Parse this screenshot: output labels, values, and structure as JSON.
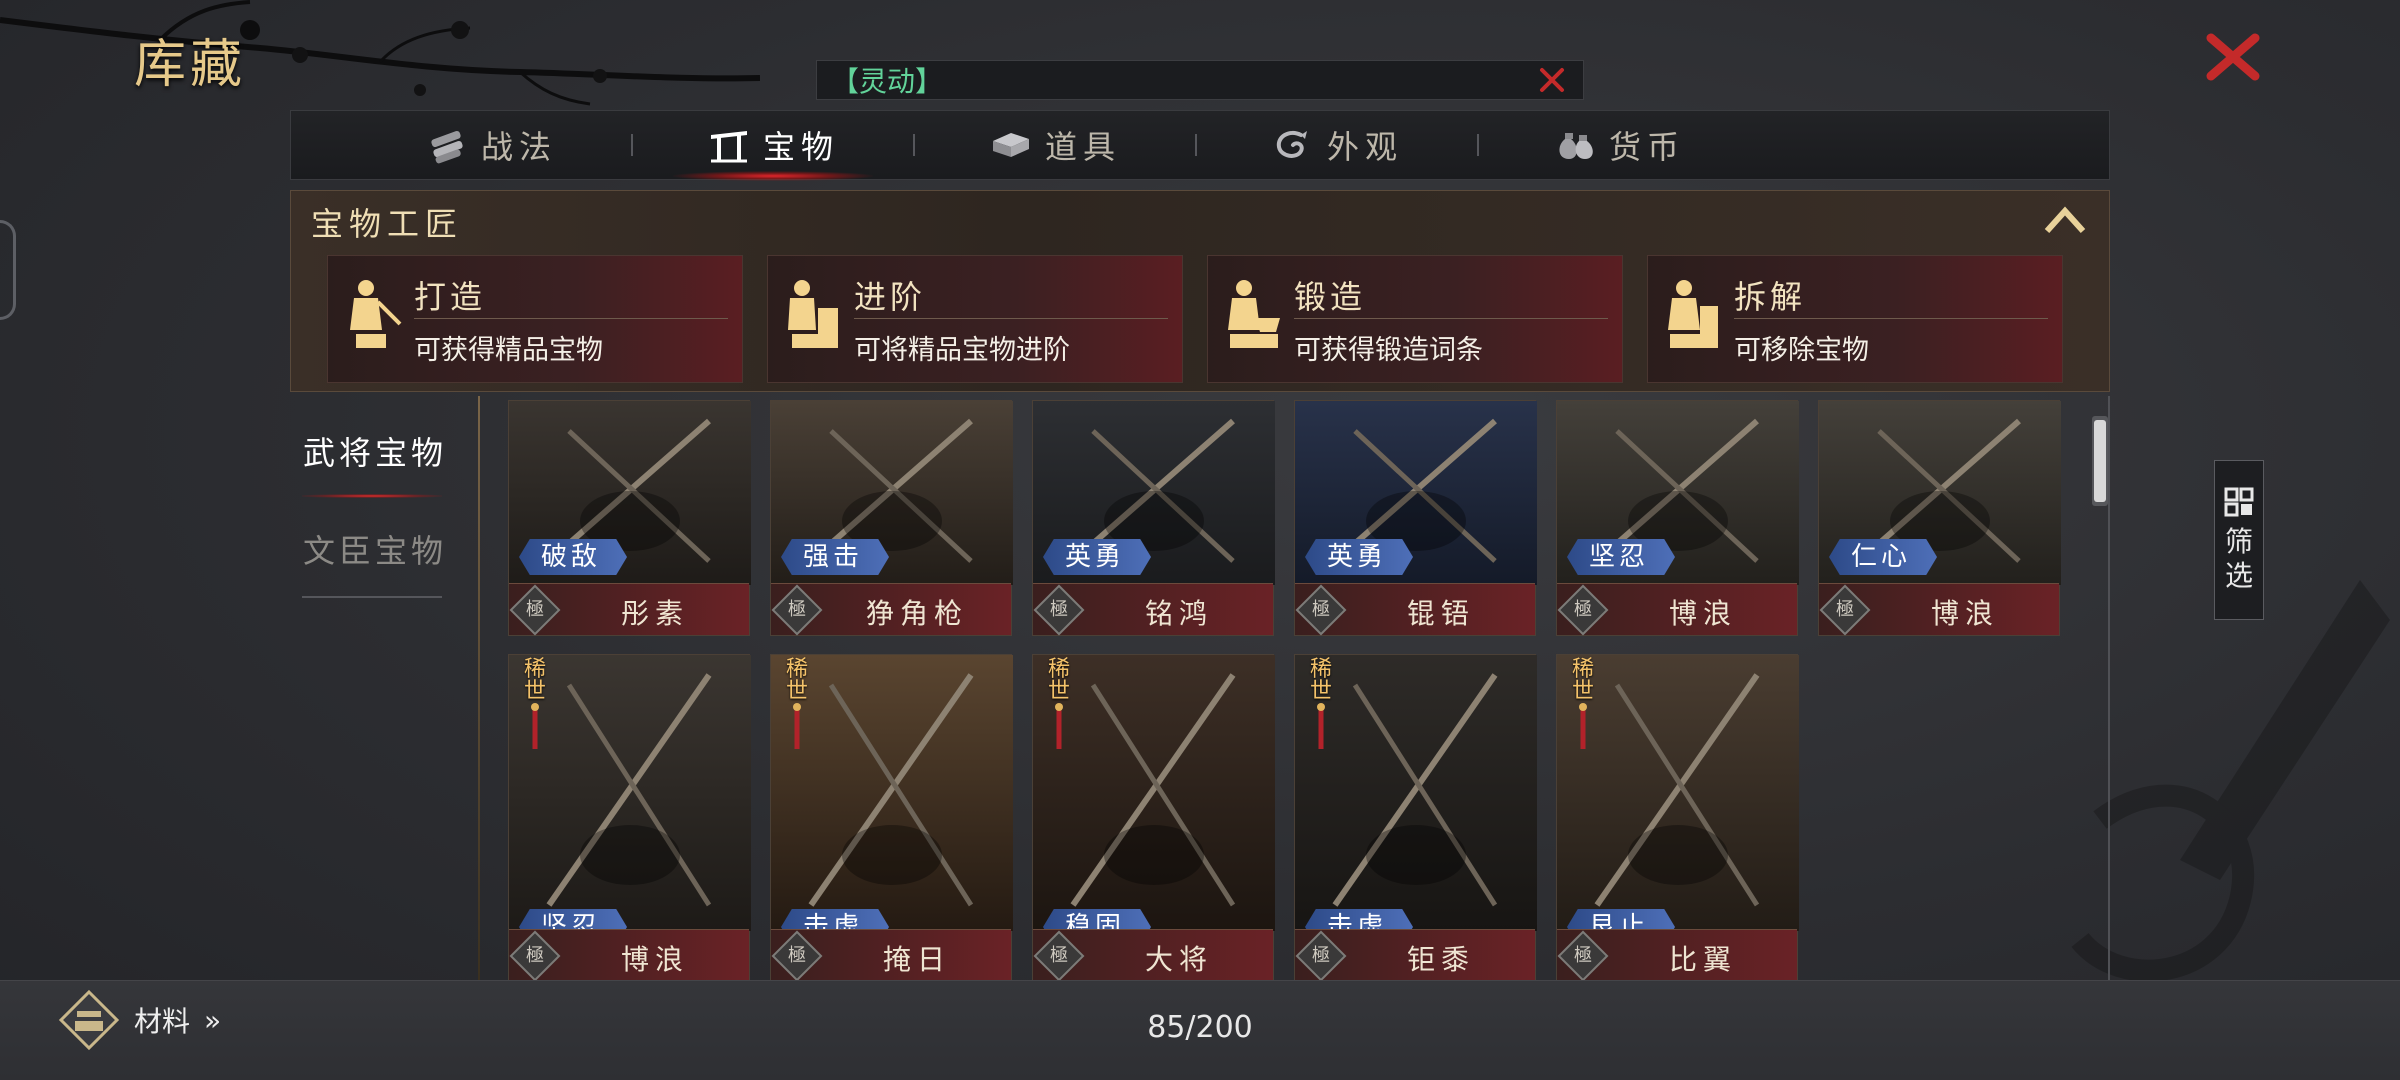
{
  "page": {
    "title": "库藏"
  },
  "search": {
    "value": "【灵动】"
  },
  "tabs": [
    {
      "label": "战法",
      "icon": "scroll-bundle-icon"
    },
    {
      "label": "宝物",
      "icon": "gate-icon",
      "active": true
    },
    {
      "label": "道具",
      "icon": "chest-icon"
    },
    {
      "label": "外观",
      "icon": "swirl-icon"
    },
    {
      "label": "货币",
      "icon": "money-bag-icon"
    }
  ],
  "artisan": {
    "title": "宝物工匠",
    "cards": [
      {
        "title": "打造",
        "desc": "可获得精品宝物"
      },
      {
        "title": "进阶",
        "desc": "可将精品宝物进阶"
      },
      {
        "title": "锻造",
        "desc": "可获得锻造词条"
      },
      {
        "title": "拆解",
        "desc": "可移除宝物"
      }
    ]
  },
  "subcategories": [
    {
      "label": "武将宝物",
      "active": true
    },
    {
      "label": "文臣宝物",
      "active": false
    }
  ],
  "items": [
    {
      "name": "彤素",
      "tag": "破敌",
      "rank": "極",
      "rare": ""
    },
    {
      "name": "狰角枪",
      "tag": "强击",
      "rank": "極",
      "rare": ""
    },
    {
      "name": "铭鸿",
      "tag": "英勇",
      "rank": "極",
      "rare": ""
    },
    {
      "name": "锟铻",
      "tag": "英勇",
      "rank": "極",
      "rare": ""
    },
    {
      "name": "博浪",
      "tag": "坚忍",
      "rank": "極",
      "rare": ""
    },
    {
      "name": "博浪",
      "tag": "仁心",
      "rank": "極",
      "rare": ""
    },
    {
      "name": "博浪",
      "tag": "坚忍",
      "rank": "極",
      "rare": "稀世"
    },
    {
      "name": "掩日",
      "tag": "击虚",
      "rank": "極",
      "rare": "稀世"
    },
    {
      "name": "大将",
      "tag": "稳固",
      "rank": "極",
      "rare": "稀世"
    },
    {
      "name": "钜黍",
      "tag": "击虚",
      "rank": "極",
      "rare": "稀世"
    },
    {
      "name": "比翼",
      "tag": "艮止",
      "rank": "極",
      "rare": "稀世"
    }
  ],
  "filter": {
    "label": "筛选"
  },
  "footer": {
    "materials": "材料",
    "materials_arrow": "»",
    "count": "85/200"
  },
  "colors": {
    "accent_red": "#e0252a",
    "gold": "#e6c98a",
    "search_green": "#62d39a",
    "tag_blue": "#3d5da3"
  }
}
